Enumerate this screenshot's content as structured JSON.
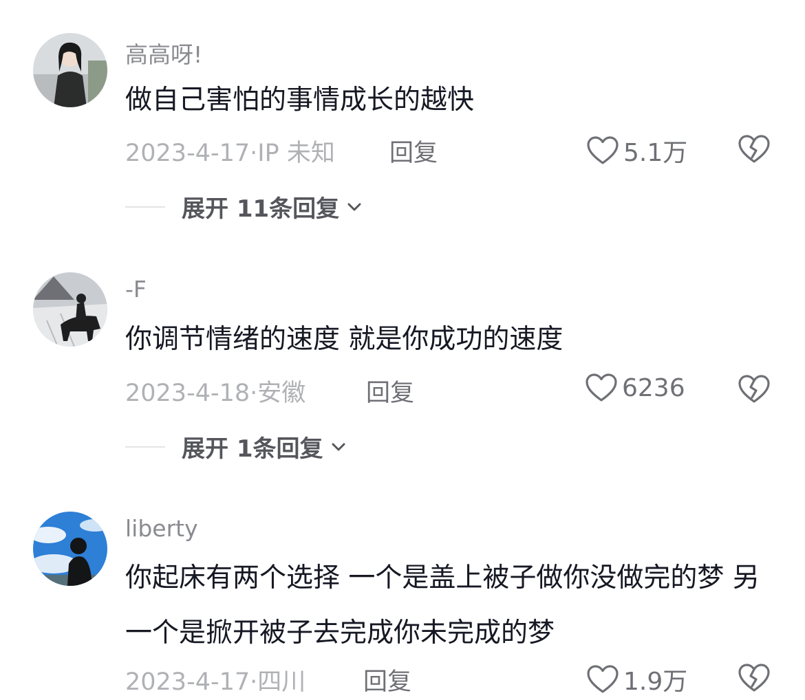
{
  "comments": [
    {
      "username": "高高呀!",
      "content": "做自己害怕的事情成长的越快",
      "date_location": "2023-4-17·IP 未知",
      "reply_label": "回复",
      "likes": "5.1万",
      "expand_label": "展开 11条回复"
    },
    {
      "username": "-F",
      "content": "你调节情绪的速度 就是你成功的速度",
      "date_location": "2023-4-18·安徽",
      "reply_label": "回复",
      "likes": "6236",
      "expand_label": "展开 1条回复"
    },
    {
      "username": "liberty",
      "content": "你起床有两个选择 一个是盖上被子做你没做完的梦 另一个是掀开被子去完成你未完成的梦",
      "date_location": "2023-4-17·四川",
      "reply_label": "回复",
      "likes": "1.9万"
    }
  ],
  "icons": {
    "like": "heart-outline-icon",
    "dislike": "broken-heart-icon",
    "expand": "chevron-down-icon"
  },
  "colors": {
    "text_primary": "#161823",
    "text_secondary": "#8a8b91",
    "text_meta": "#b0b1b5",
    "icon": "#6f7075"
  }
}
